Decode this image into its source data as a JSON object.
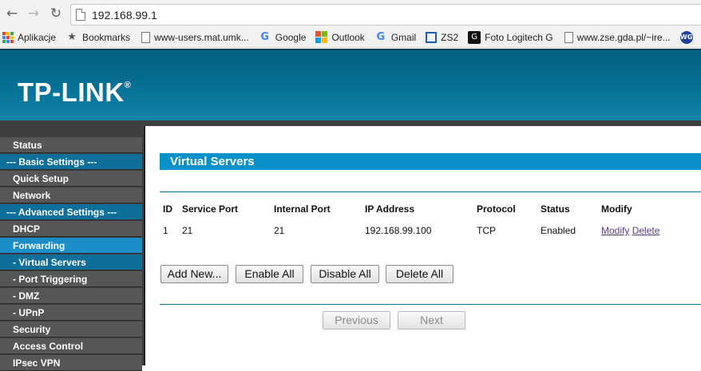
{
  "browser": {
    "url": "192.168.99.1",
    "bookmarks": [
      {
        "label": "Aplikacje",
        "icon": "apps-icon"
      },
      {
        "label": "Bookmarks",
        "icon": "star-icon"
      },
      {
        "label": "www-users.mat.umk...",
        "icon": "page-icon"
      },
      {
        "label": "Google",
        "icon": "google-icon"
      },
      {
        "label": "Outlook",
        "icon": "windows-icon"
      },
      {
        "label": "Gmail",
        "icon": "google-icon"
      },
      {
        "label": "ZS2",
        "icon": "zs2-icon"
      },
      {
        "label": "Foto Logitech G",
        "icon": "logitech-icon"
      },
      {
        "label": "www.zse.gda.pl/~ire...",
        "icon": "page-icon"
      }
    ],
    "wg_badge": "WG"
  },
  "header": {
    "logo": "TP-LINK",
    "trademark": "®"
  },
  "sidebar": {
    "items": [
      {
        "label": "Status",
        "kind": "item"
      },
      {
        "label": "--- Basic Settings ---",
        "kind": "section"
      },
      {
        "label": "Quick Setup",
        "kind": "item"
      },
      {
        "label": "Network",
        "kind": "item"
      },
      {
        "label": "--- Advanced Settings ---",
        "kind": "section"
      },
      {
        "label": "DHCP",
        "kind": "item"
      },
      {
        "label": "Forwarding",
        "kind": "active"
      },
      {
        "label": "- Virtual Servers",
        "kind": "sub-current"
      },
      {
        "label": "- Port Triggering",
        "kind": "sub"
      },
      {
        "label": "- DMZ",
        "kind": "sub"
      },
      {
        "label": "- UPnP",
        "kind": "sub"
      },
      {
        "label": "Security",
        "kind": "item"
      },
      {
        "label": "Access Control",
        "kind": "item"
      },
      {
        "label": "IPsec VPN",
        "kind": "item"
      }
    ]
  },
  "main": {
    "title": "Virtual Servers",
    "table": {
      "headers": [
        "ID",
        "Service Port",
        "Internal Port",
        "IP Address",
        "Protocol",
        "Status",
        "Modify"
      ],
      "rows": [
        {
          "id": "1",
          "service_port": "21",
          "internal_port": "21",
          "ip": "192.168.99.100",
          "protocol": "TCP",
          "status": "Enabled",
          "modify": "Modify",
          "delete": "Delete"
        }
      ]
    },
    "buttons": {
      "add_new": "Add New...",
      "enable_all": "Enable All",
      "disable_all": "Disable All",
      "delete_all": "Delete All"
    },
    "pager": {
      "previous": "Previous",
      "next": "Next"
    }
  },
  "colors": {
    "header": "#056f93",
    "title_bar": "#0a91c9",
    "sidebar": "#3f3f3f",
    "section": "#0e6f9a",
    "active": "#1b8ec9",
    "link": "#5b3a8a"
  }
}
